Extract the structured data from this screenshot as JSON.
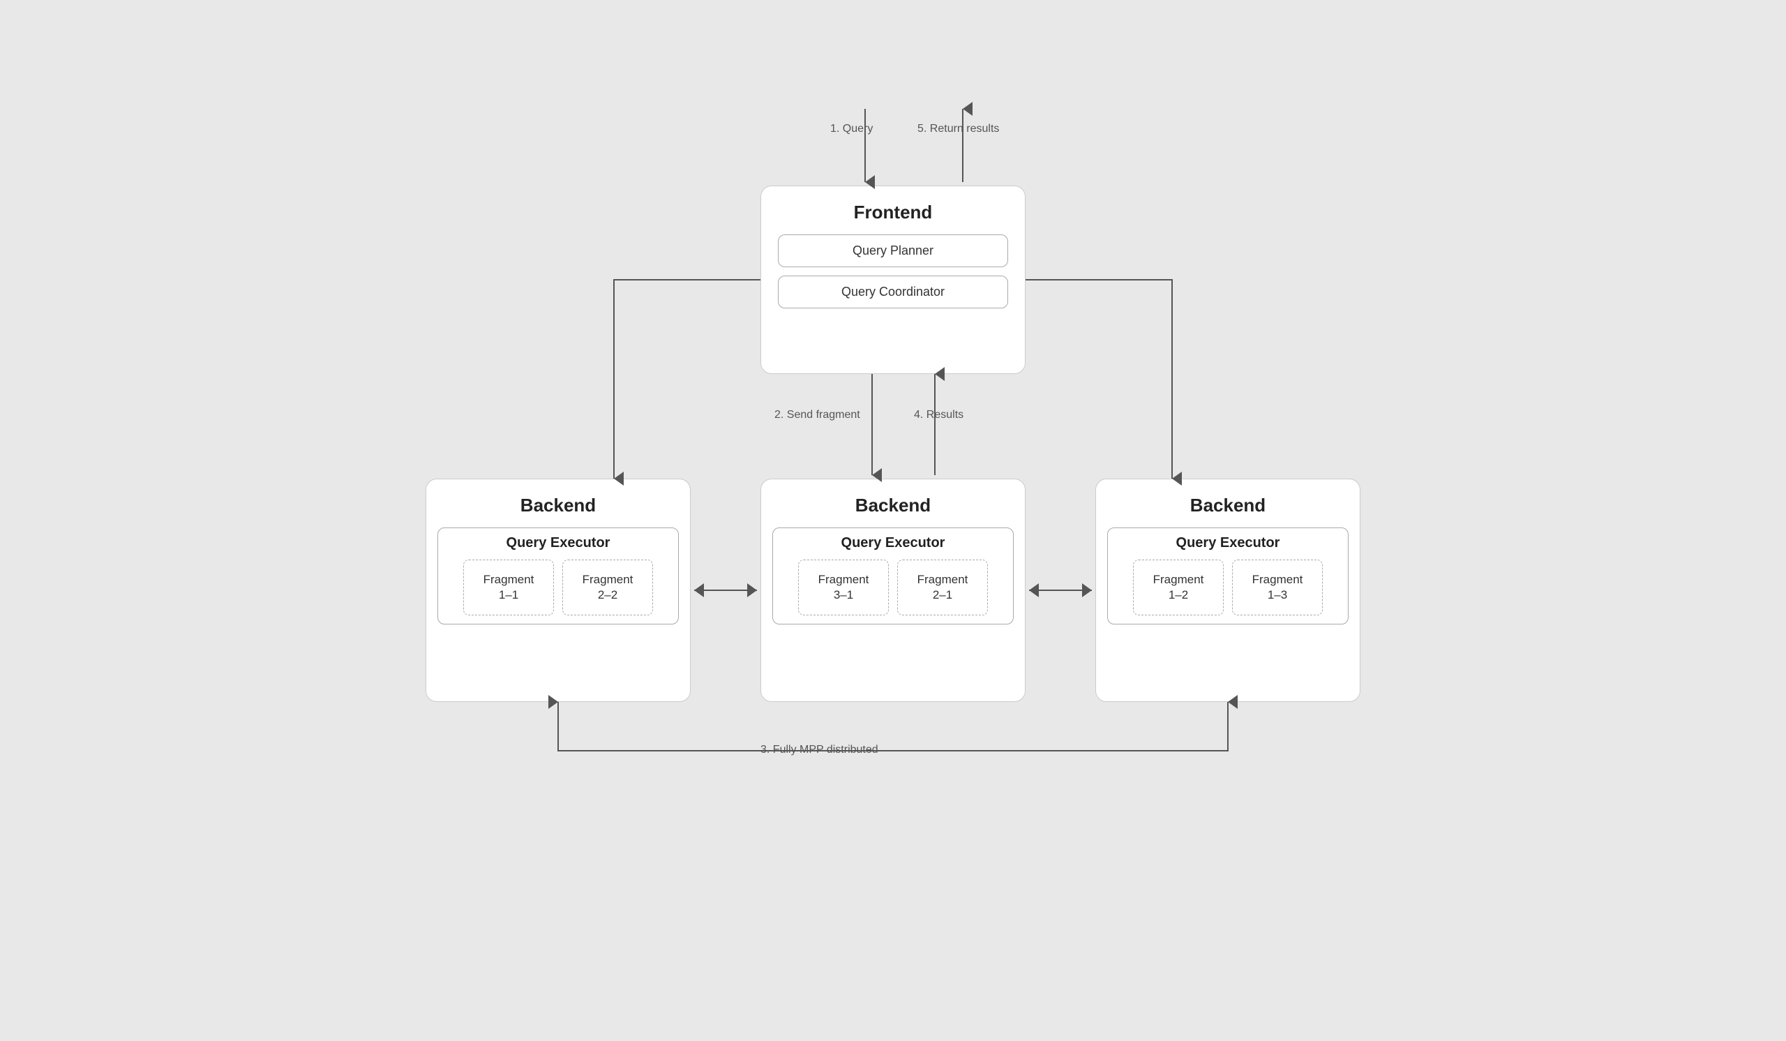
{
  "diagram": {
    "frontend": {
      "title": "Frontend",
      "query_planner": "Query Planner",
      "query_coordinator": "Query Coordinator"
    },
    "backends": [
      {
        "title": "Backend",
        "executor": "Query Executor",
        "fragments": [
          "Fragment\n1–1",
          "Fragment\n2–2"
        ]
      },
      {
        "title": "Backend",
        "executor": "Query Executor",
        "fragments": [
          "Fragment\n3–1",
          "Fragment\n2–1"
        ]
      },
      {
        "title": "Backend",
        "executor": "Query Executor",
        "fragments": [
          "Fragment\n1–2",
          "Fragment\n1–3"
        ]
      }
    ],
    "arrow_labels": {
      "step1": "1. Query",
      "step2": "2. Send fragment",
      "step3": "3. Fully MPP distributed",
      "step4": "4. Results",
      "step5": "5. Return results"
    }
  }
}
